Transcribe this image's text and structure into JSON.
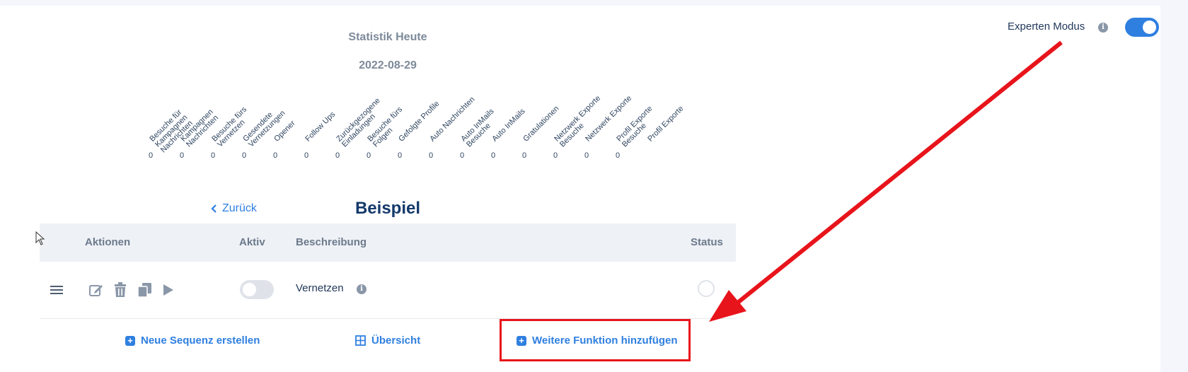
{
  "stats": {
    "title": "Statistik Heute",
    "date": "2022-08-29",
    "items": [
      {
        "label": "Besuche für\nKampagnen\nNachrichten",
        "value": "0"
      },
      {
        "label": "Kampagnen\nNachrichten",
        "value": "0"
      },
      {
        "label": "Besuche fürs\nVernetzen",
        "value": "0"
      },
      {
        "label": "Gesendete\nVernetzungen",
        "value": "0"
      },
      {
        "label": "Opener",
        "value": "0"
      },
      {
        "label": "Follow Ups",
        "value": "0"
      },
      {
        "label": "Zurückgezogene\nEinladungen",
        "value": "0"
      },
      {
        "label": "Besuche fürs\nFolgen",
        "value": "0"
      },
      {
        "label": "Gefolgte Profile",
        "value": "0"
      },
      {
        "label": "Auto Nachrichten",
        "value": "0"
      },
      {
        "label": "Auto InMails\nBesuche",
        "value": "0"
      },
      {
        "label": "Auto InMails",
        "value": "0"
      },
      {
        "label": "Gratulationen",
        "value": "0"
      },
      {
        "label": "Netzwerk Exporte\nBesuche",
        "value": "0"
      },
      {
        "label": "Netzwerk Exporte",
        "value": "0"
      },
      {
        "label": "Profil Exporte\nBesuche",
        "value": "0"
      },
      {
        "label": "Profil Exporte",
        "value": ""
      }
    ]
  },
  "expert_mode": {
    "label": "Experten Modus",
    "info_icon": "info-icon",
    "enabled": true
  },
  "nav": {
    "back_label": "Zurück",
    "back_icon": "chevron-left-icon"
  },
  "page": {
    "heading": "Beispiel"
  },
  "table": {
    "headers": {
      "actions": "Aktionen",
      "active": "Aktiv",
      "description": "Beschreibung",
      "status": "Status"
    },
    "rows": [
      {
        "drag_icon": "drag-handle-icon",
        "action_icons": [
          "edit-icon",
          "trash-icon",
          "copy-icon",
          "play-icon"
        ],
        "active": false,
        "description": "Vernetzen",
        "status": "inactive"
      }
    ]
  },
  "footer": {
    "new_sequence": "Neue Sequenz erstellen",
    "overview": "Übersicht",
    "add_function": "Weitere Funktion hinzufügen"
  },
  "colors": {
    "accent": "#2f7fe0",
    "heading": "#143a6b",
    "annotation": "#e8141b"
  }
}
